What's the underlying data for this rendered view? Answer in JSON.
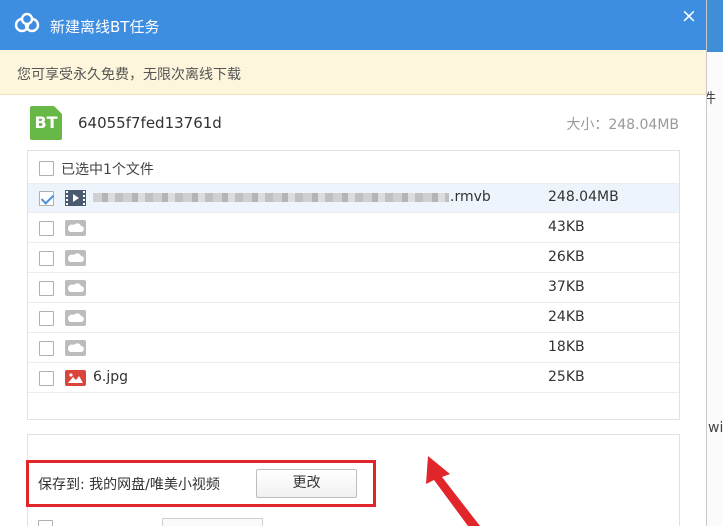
{
  "window": {
    "title": "新建离线BT任务",
    "close_symbol": "×"
  },
  "notice": {
    "text": "您可享受永久免费，无限次离线下载"
  },
  "torrent": {
    "badge": "BT",
    "name": "64055f7fed13761d",
    "size_label": "大小：248.04MB"
  },
  "file_list": {
    "header_label": "已选中1个文件",
    "header_checked": false,
    "rows": [
      {
        "name": ".rmvb",
        "name_redacted": true,
        "size": "248.04MB",
        "checked": true,
        "icon": "video-file-icon"
      },
      {
        "name": "",
        "size": "43KB",
        "checked": false,
        "icon": "cloud-file-icon"
      },
      {
        "name": "",
        "size": "26KB",
        "checked": false,
        "icon": "cloud-file-icon"
      },
      {
        "name": "",
        "size": "37KB",
        "checked": false,
        "icon": "cloud-file-icon"
      },
      {
        "name": "",
        "size": "24KB",
        "checked": false,
        "icon": "cloud-file-icon"
      },
      {
        "name": "",
        "size": "18KB",
        "checked": false,
        "icon": "cloud-file-icon"
      },
      {
        "name": "6.jpg",
        "size": "25KB",
        "checked": false,
        "icon": "image-file-icon"
      }
    ]
  },
  "save": {
    "label": "保存到: 我的网盘/唯美小视频",
    "change_button": "更改"
  },
  "background_app": {
    "text_top": "件",
    "text_bottom": "wir"
  },
  "colors": {
    "title_bar": "#3d8de0",
    "notice_bg": "#fdf5dc",
    "bt_badge": "#67b847",
    "highlight": "#e0262b",
    "selected_row": "#edf4fc"
  }
}
